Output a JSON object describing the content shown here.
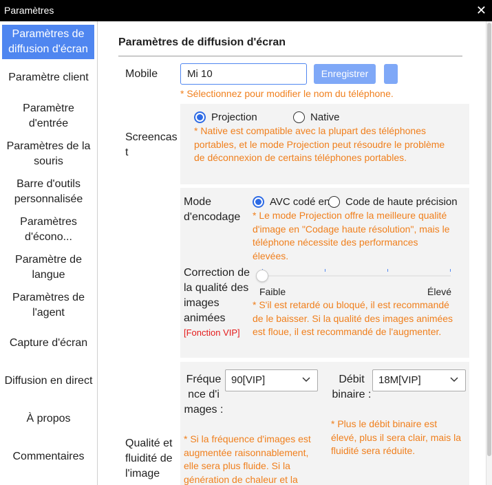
{
  "window": {
    "title": "Paramètres",
    "close_symbol": "✕"
  },
  "sidebar": {
    "items": [
      {
        "label": "Paramètres de diffusion d'écran"
      },
      {
        "label": "Paramètre client"
      },
      {
        "label": "Paramètre d'entrée"
      },
      {
        "label": "Paramètres de la souris"
      },
      {
        "label": "Barre d'outils personnalisée"
      },
      {
        "label": "Paramètres d'écono..."
      },
      {
        "label": "Paramètre de langue"
      },
      {
        "label": "Paramètres de l'agent"
      },
      {
        "label": "Capture d'écran"
      },
      {
        "label": "Diffusion en direct"
      },
      {
        "label": "À propos"
      },
      {
        "label": "Commentaires"
      }
    ]
  },
  "main": {
    "section_title": "Paramètres de diffusion d'écran",
    "mobile": {
      "label": "Mobile",
      "value": "Mi 10",
      "save_label": "Enregistrer",
      "note": "* Sélectionnez pour modifier le nom du téléphone."
    },
    "screencast": {
      "label": "Screencast",
      "options": [
        "Projection",
        "Native"
      ],
      "selected": "Projection",
      "note": "* Native est compatible avec la plupart des téléphones portables, et le mode Projection peut résoudre le problème de déconnexion de certains téléphones portables."
    },
    "encoding": {
      "label": "Mode d'encodage",
      "options": [
        "AVC codé en",
        "Code de haute précision"
      ],
      "selected": "AVC codé en",
      "note": "* Le mode Projection offre la meilleure qualité d'image en \"Codage haute résolution\", mais le téléphone nécessite des performances élevées."
    },
    "motion_quality": {
      "label": "Correction de la qualité des images animées",
      "vip": "[Fonction VIP]",
      "min_label": "Faible",
      "max_label": "Élevé",
      "level": 0,
      "note": "* S'il est retardé ou bloqué, il est recommandé de le baisser. Si la qualité des images animées est floue, il est recommandé de l'augmenter."
    },
    "quality": {
      "label": "Qualité et fluidité de l'image",
      "frame_rate_label": "Fréquence d'images :",
      "frame_rate_value": "90[VIP]",
      "frame_rate_note": "* Si la fréquence d'images est augmentée raisonnablement, elle sera plus fluide. Si la génération de chaleur et la",
      "bitrate_label": "Débit binaire :",
      "bitrate_value": "18M[VIP]",
      "bitrate_note": "* Plus le débit binaire est élevé, plus il sera clair, mais la fluidité sera réduite."
    }
  },
  "colors": {
    "accent": "#4f86f0",
    "button": "#7fa8f7",
    "note": "#f07f1c",
    "vip": "#e41b1b",
    "panel": "#f3f3f3"
  }
}
